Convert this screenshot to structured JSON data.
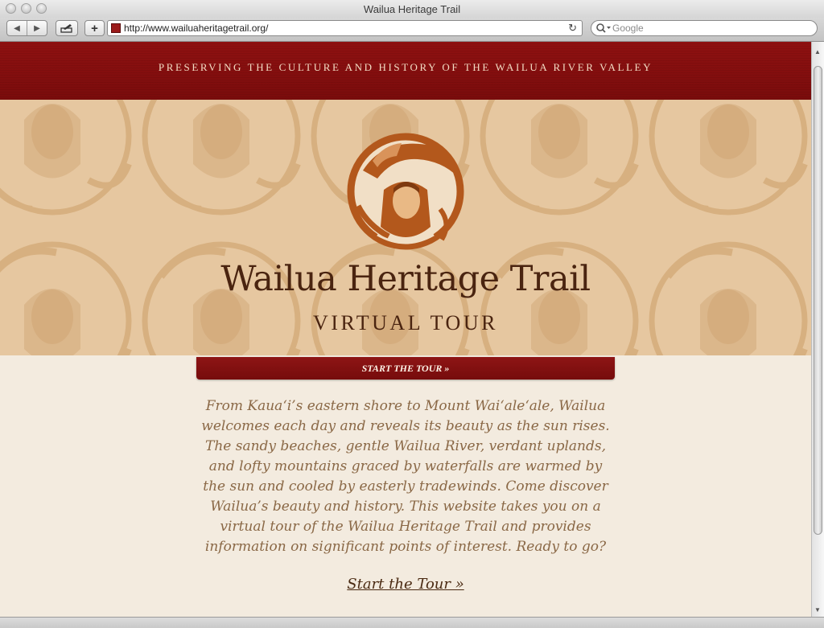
{
  "window": {
    "title": "Wailua Heritage Trail"
  },
  "toolbar": {
    "url": "http://www.wailuaheritagetrail.org/",
    "search_placeholder": "Google",
    "back_glyph": "◀",
    "forward_glyph": "▶",
    "add_glyph": "+",
    "reload_glyph": "↻"
  },
  "page": {
    "tagline": "PRESERVING THE CULTURE AND HISTORY OF THE WAILUA RIVER VALLEY",
    "title": "Wailua Heritage Trail",
    "subtitle": "VIRTUAL TOUR",
    "start_bar_label": "START THE TOUR »",
    "intro": "From Kaua‘i’s eastern shore to Mount Wai‘ale‘ale, Wailua welcomes each day and reveals its beauty as the sun rises. The sandy beaches, gentle Wailua River, verdant uplands, and lofty mountains graced by waterfalls are warmed by the sun and cooled by easterly tradewinds. Come discover Wailua’s beauty and history. This website takes you on a virtual tour of the Wailua Heritage Trail and provides information on significant points of interest. Ready to go?",
    "start_link": "Start the Tour »"
  },
  "colors": {
    "banner": "#8a1010",
    "hero_bg": "#e6c7a0",
    "pattern": "#d9b486",
    "emblem": "#b3581c",
    "title": "#4a2410",
    "body_bg": "#f3ebdf",
    "intro_text": "#8a6846"
  },
  "icons": [
    "back-icon",
    "forward-icon",
    "compose-icon",
    "add-icon",
    "favicon",
    "reload-icon",
    "search-icon",
    "emblem-logo"
  ]
}
